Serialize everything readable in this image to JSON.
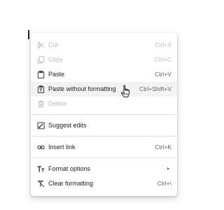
{
  "context_menu": {
    "items": [
      {
        "label": "Cut",
        "shortcut": "Ctrl+X",
        "icon": "scissors-icon",
        "enabled": false
      },
      {
        "label": "Copy",
        "shortcut": "Ctrl+C",
        "icon": "copy-icon",
        "enabled": false
      },
      {
        "label": "Paste",
        "shortcut": "Ctrl+V",
        "icon": "clipboard-icon",
        "enabled": true
      },
      {
        "label": "Paste without formatting",
        "shortcut": "Ctrl+Shift+V",
        "icon": "paste-plain-icon",
        "enabled": true,
        "hovered": true
      },
      {
        "label": "Delete",
        "shortcut": "",
        "icon": "trash-icon",
        "enabled": false
      },
      {
        "label": "Suggest edits",
        "shortcut": "",
        "icon": "suggest-edits-icon",
        "enabled": true
      },
      {
        "label": "Insert link",
        "shortcut": "Ctrl+K",
        "icon": "link-icon",
        "enabled": true
      },
      {
        "label": "Format options",
        "shortcut": "",
        "icon": "format-options-icon",
        "enabled": true,
        "submenu": true
      },
      {
        "label": "Clear formatting",
        "shortcut": "Ctrl+\\",
        "icon": "clear-formatting-icon",
        "enabled": true
      }
    ]
  },
  "colors": {
    "text": "#202124",
    "disabled_text": "#b8bcc0",
    "shortcut_text": "#5f6368",
    "hover_background": "#f1f3f4",
    "divider": "#e0e0e0"
  }
}
